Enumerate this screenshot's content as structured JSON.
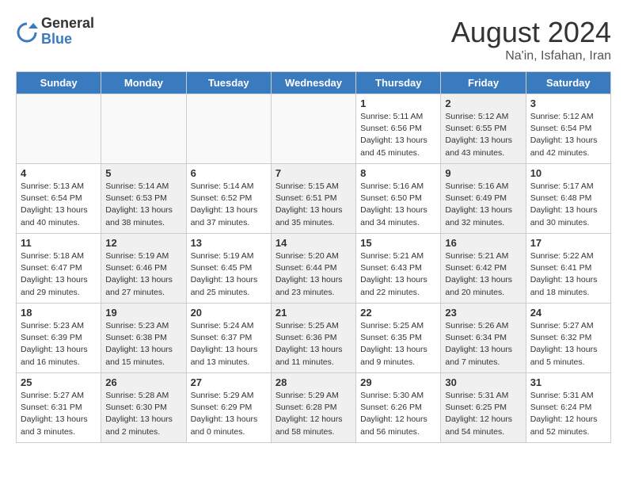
{
  "header": {
    "logo_line1": "General",
    "logo_line2": "Blue",
    "month": "August 2024",
    "location": "Na'in, Isfahan, Iran"
  },
  "weekdays": [
    "Sunday",
    "Monday",
    "Tuesday",
    "Wednesday",
    "Thursday",
    "Friday",
    "Saturday"
  ],
  "weeks": [
    [
      {
        "day": "",
        "info": "",
        "empty": true
      },
      {
        "day": "",
        "info": "",
        "empty": true
      },
      {
        "day": "",
        "info": "",
        "empty": true
      },
      {
        "day": "",
        "info": "",
        "empty": true
      },
      {
        "day": "1",
        "info": "Sunrise: 5:11 AM\nSunset: 6:56 PM\nDaylight: 13 hours\nand 45 minutes."
      },
      {
        "day": "2",
        "info": "Sunrise: 5:12 AM\nSunset: 6:55 PM\nDaylight: 13 hours\nand 43 minutes.",
        "shaded": true
      },
      {
        "day": "3",
        "info": "Sunrise: 5:12 AM\nSunset: 6:54 PM\nDaylight: 13 hours\nand 42 minutes."
      }
    ],
    [
      {
        "day": "4",
        "info": "Sunrise: 5:13 AM\nSunset: 6:54 PM\nDaylight: 13 hours\nand 40 minutes."
      },
      {
        "day": "5",
        "info": "Sunrise: 5:14 AM\nSunset: 6:53 PM\nDaylight: 13 hours\nand 38 minutes.",
        "shaded": true
      },
      {
        "day": "6",
        "info": "Sunrise: 5:14 AM\nSunset: 6:52 PM\nDaylight: 13 hours\nand 37 minutes."
      },
      {
        "day": "7",
        "info": "Sunrise: 5:15 AM\nSunset: 6:51 PM\nDaylight: 13 hours\nand 35 minutes.",
        "shaded": true
      },
      {
        "day": "8",
        "info": "Sunrise: 5:16 AM\nSunset: 6:50 PM\nDaylight: 13 hours\nand 34 minutes."
      },
      {
        "day": "9",
        "info": "Sunrise: 5:16 AM\nSunset: 6:49 PM\nDaylight: 13 hours\nand 32 minutes.",
        "shaded": true
      },
      {
        "day": "10",
        "info": "Sunrise: 5:17 AM\nSunset: 6:48 PM\nDaylight: 13 hours\nand 30 minutes."
      }
    ],
    [
      {
        "day": "11",
        "info": "Sunrise: 5:18 AM\nSunset: 6:47 PM\nDaylight: 13 hours\nand 29 minutes."
      },
      {
        "day": "12",
        "info": "Sunrise: 5:19 AM\nSunset: 6:46 PM\nDaylight: 13 hours\nand 27 minutes.",
        "shaded": true
      },
      {
        "day": "13",
        "info": "Sunrise: 5:19 AM\nSunset: 6:45 PM\nDaylight: 13 hours\nand 25 minutes."
      },
      {
        "day": "14",
        "info": "Sunrise: 5:20 AM\nSunset: 6:44 PM\nDaylight: 13 hours\nand 23 minutes.",
        "shaded": true
      },
      {
        "day": "15",
        "info": "Sunrise: 5:21 AM\nSunset: 6:43 PM\nDaylight: 13 hours\nand 22 minutes."
      },
      {
        "day": "16",
        "info": "Sunrise: 5:21 AM\nSunset: 6:42 PM\nDaylight: 13 hours\nand 20 minutes.",
        "shaded": true
      },
      {
        "day": "17",
        "info": "Sunrise: 5:22 AM\nSunset: 6:41 PM\nDaylight: 13 hours\nand 18 minutes."
      }
    ],
    [
      {
        "day": "18",
        "info": "Sunrise: 5:23 AM\nSunset: 6:39 PM\nDaylight: 13 hours\nand 16 minutes."
      },
      {
        "day": "19",
        "info": "Sunrise: 5:23 AM\nSunset: 6:38 PM\nDaylight: 13 hours\nand 15 minutes.",
        "shaded": true
      },
      {
        "day": "20",
        "info": "Sunrise: 5:24 AM\nSunset: 6:37 PM\nDaylight: 13 hours\nand 13 minutes."
      },
      {
        "day": "21",
        "info": "Sunrise: 5:25 AM\nSunset: 6:36 PM\nDaylight: 13 hours\nand 11 minutes.",
        "shaded": true
      },
      {
        "day": "22",
        "info": "Sunrise: 5:25 AM\nSunset: 6:35 PM\nDaylight: 13 hours\nand 9 minutes."
      },
      {
        "day": "23",
        "info": "Sunrise: 5:26 AM\nSunset: 6:34 PM\nDaylight: 13 hours\nand 7 minutes.",
        "shaded": true
      },
      {
        "day": "24",
        "info": "Sunrise: 5:27 AM\nSunset: 6:32 PM\nDaylight: 13 hours\nand 5 minutes."
      }
    ],
    [
      {
        "day": "25",
        "info": "Sunrise: 5:27 AM\nSunset: 6:31 PM\nDaylight: 13 hours\nand 3 minutes."
      },
      {
        "day": "26",
        "info": "Sunrise: 5:28 AM\nSunset: 6:30 PM\nDaylight: 13 hours\nand 2 minutes.",
        "shaded": true
      },
      {
        "day": "27",
        "info": "Sunrise: 5:29 AM\nSunset: 6:29 PM\nDaylight: 13 hours\nand 0 minutes."
      },
      {
        "day": "28",
        "info": "Sunrise: 5:29 AM\nSunset: 6:28 PM\nDaylight: 12 hours\nand 58 minutes.",
        "shaded": true
      },
      {
        "day": "29",
        "info": "Sunrise: 5:30 AM\nSunset: 6:26 PM\nDaylight: 12 hours\nand 56 minutes."
      },
      {
        "day": "30",
        "info": "Sunrise: 5:31 AM\nSunset: 6:25 PM\nDaylight: 12 hours\nand 54 minutes.",
        "shaded": true
      },
      {
        "day": "31",
        "info": "Sunrise: 5:31 AM\nSunset: 6:24 PM\nDaylight: 12 hours\nand 52 minutes."
      }
    ]
  ]
}
